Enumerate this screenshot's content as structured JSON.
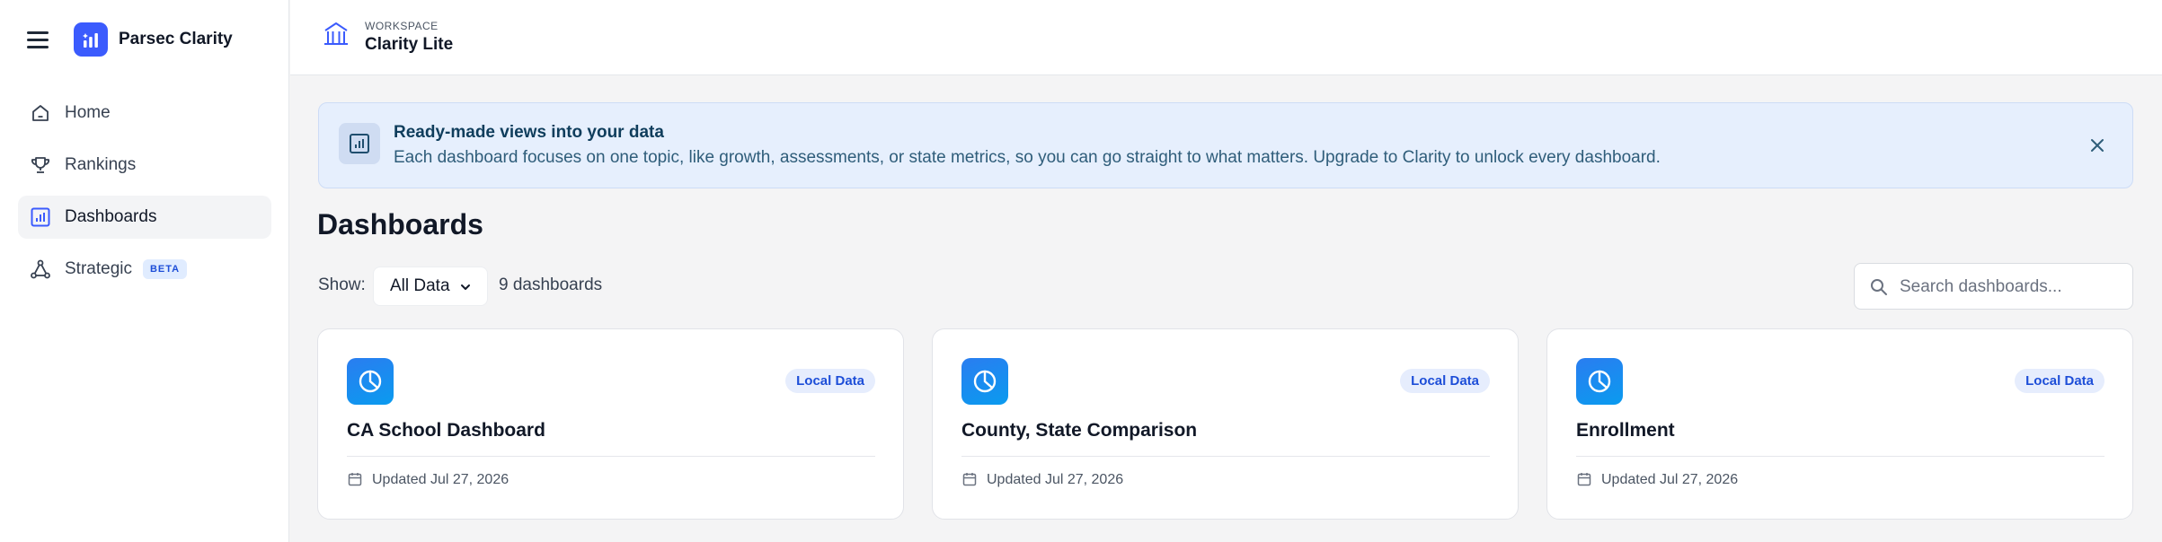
{
  "app": {
    "name": "Parsec Clarity"
  },
  "sidebar": {
    "items": [
      {
        "label": "Home",
        "icon": "home-icon"
      },
      {
        "label": "Rankings",
        "icon": "trophy-icon"
      },
      {
        "label": "Dashboards",
        "icon": "chart-icon",
        "active": true
      },
      {
        "label": "Strategic",
        "icon": "network-icon",
        "badge": "BETA"
      }
    ]
  },
  "workspace": {
    "caption": "WORKSPACE",
    "name": "Clarity Lite"
  },
  "banner": {
    "title": "Ready-made views into your data",
    "text": "Each dashboard focuses on one topic, like growth, assessments, or state metrics, so you can go straight to what matters. Upgrade to Clarity to unlock every dashboard."
  },
  "page": {
    "title": "Dashboards"
  },
  "filter": {
    "show_label": "Show:",
    "selected": "All Data",
    "count": "9 dashboards"
  },
  "search": {
    "placeholder": "Search dashboards..."
  },
  "cards": [
    {
      "title": "CA School Dashboard",
      "badge": "Local Data",
      "updated": "Updated Jul 27, 2026"
    },
    {
      "title": "County, State Comparison",
      "badge": "Local Data",
      "updated": "Updated Jul 27, 2026"
    },
    {
      "title": "Enrollment",
      "badge": "Local Data",
      "updated": "Updated Jul 27, 2026"
    }
  ],
  "colors": {
    "accent": "#3b5bfd",
    "banner_bg": "#e6effd",
    "card_icon": "#1a8cef",
    "badge_bg": "#e6edfd"
  }
}
